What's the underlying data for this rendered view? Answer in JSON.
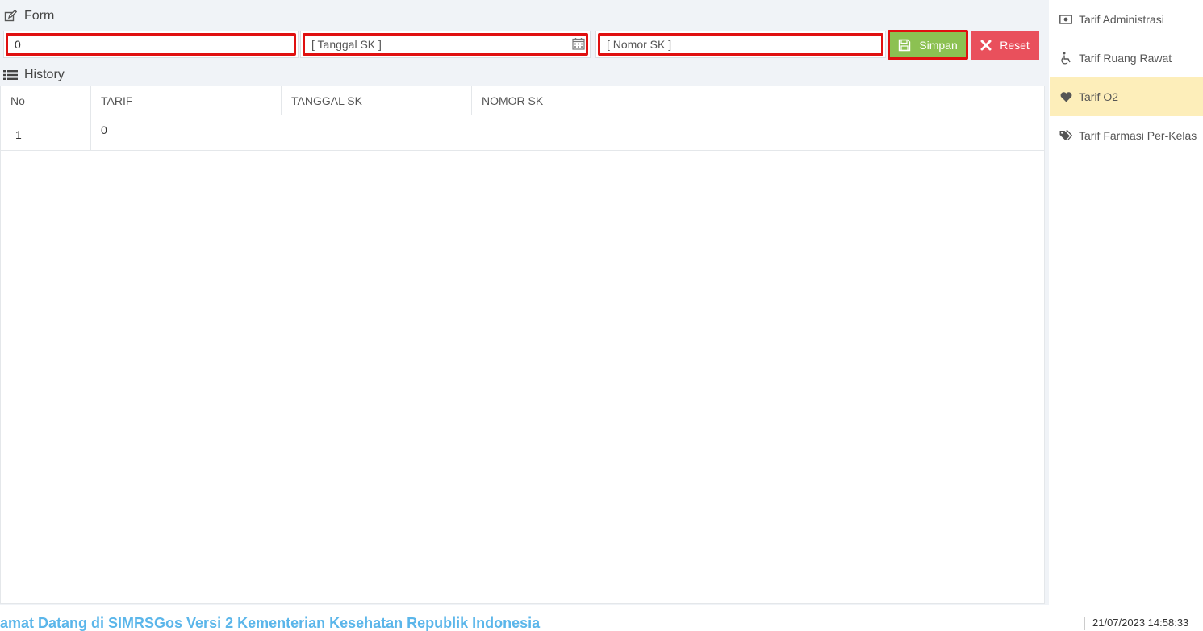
{
  "form": {
    "title": "Form",
    "tarif_value": "0",
    "tanggal_placeholder": "[ Tanggal SK ]",
    "nomor_placeholder": "[ Nomor SK ]",
    "save_label": "Simpan",
    "reset_label": "Reset"
  },
  "history": {
    "title": "History",
    "columns": [
      "No",
      "TARIF",
      "TANGGAL SK",
      "NOMOR SK"
    ],
    "rows": [
      {
        "no": "1",
        "tarif": "0",
        "tanggal": "",
        "nomor": ""
      }
    ]
  },
  "sidebar": {
    "items": [
      {
        "label": "Tarif Administrasi",
        "icon": "money-icon"
      },
      {
        "label": "Tarif Ruang Rawat",
        "icon": "wheelchair-icon"
      },
      {
        "label": "Tarif O2",
        "icon": "heart-icon",
        "active": true
      },
      {
        "label": "Tarif Farmasi Per-Kelas",
        "icon": "tags-icon"
      }
    ]
  },
  "footer": {
    "marquee": "amat Datang di SIMRSGos Versi 2 Kementerian Kesehatan Republik Indonesia",
    "datetime": "21/07/2023 14:58:33"
  },
  "colors": {
    "save": "#8cc152",
    "reset": "#e9505c",
    "active_sidebar": "#fdeeba",
    "marquee": "#5bb6ea",
    "highlight": "#e01010"
  }
}
